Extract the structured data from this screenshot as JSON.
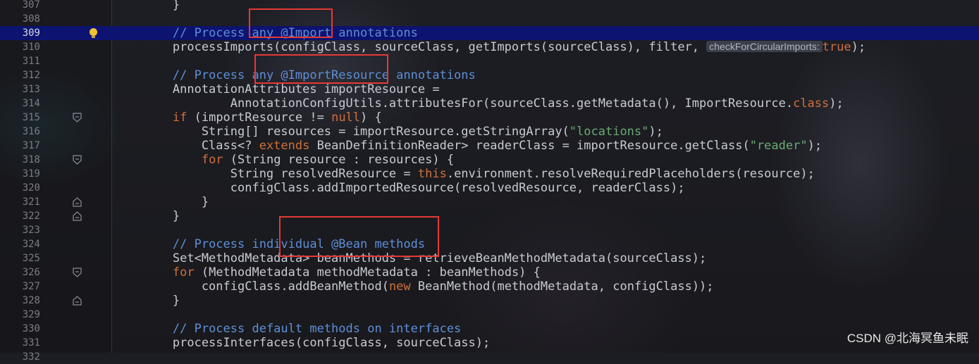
{
  "editor": {
    "current_line": "309",
    "param_hint": "checkForCircularImports:",
    "lines": [
      {
        "num": "307",
        "tokens": [
          {
            "c": "",
            "t": "        }"
          }
        ]
      },
      {
        "num": "308",
        "tokens": []
      },
      {
        "num": "309",
        "tokens": [
          {
            "c": "",
            "t": "        "
          },
          {
            "c": "t-cm",
            "t": "// Process any @Import annotations"
          }
        ]
      },
      {
        "num": "310",
        "tokens": [
          {
            "c": "",
            "t": "        processImports(configClass, sourceClass, getImports(sourceClass), filter, "
          },
          {
            "c": "hint",
            "t": ""
          },
          {
            "c": "t-kw",
            "t": "true"
          },
          {
            "c": "",
            "t": ");"
          }
        ]
      },
      {
        "num": "311",
        "tokens": []
      },
      {
        "num": "312",
        "tokens": [
          {
            "c": "",
            "t": "        "
          },
          {
            "c": "t-cm",
            "t": "// Process any @ImportResource annotations"
          }
        ]
      },
      {
        "num": "313",
        "tokens": [
          {
            "c": "",
            "t": "        AnnotationAttributes importResource ="
          }
        ]
      },
      {
        "num": "314",
        "tokens": [
          {
            "c": "",
            "t": "                AnnotationConfigUtils.attributesFor(sourceClass.getMetadata(), ImportResource."
          },
          {
            "c": "t-kw",
            "t": "class"
          },
          {
            "c": "",
            "t": ");"
          }
        ]
      },
      {
        "num": "315",
        "tokens": [
          {
            "c": "",
            "t": "        "
          },
          {
            "c": "t-kw",
            "t": "if"
          },
          {
            "c": "",
            "t": " (importResource != "
          },
          {
            "c": "t-kw",
            "t": "null"
          },
          {
            "c": "",
            "t": ") {"
          }
        ]
      },
      {
        "num": "316",
        "tokens": [
          {
            "c": "",
            "t": "            String[] resources = importResource.getStringArray("
          },
          {
            "c": "t-str",
            "t": "\"locations\""
          },
          {
            "c": "",
            "t": ");"
          }
        ]
      },
      {
        "num": "317",
        "tokens": [
          {
            "c": "",
            "t": "            Class<? "
          },
          {
            "c": "t-kw",
            "t": "extends"
          },
          {
            "c": "",
            "t": " BeanDefinitionReader> readerClass = importResource.getClass("
          },
          {
            "c": "t-str",
            "t": "\"reader\""
          },
          {
            "c": "",
            "t": ");"
          }
        ]
      },
      {
        "num": "318",
        "tokens": [
          {
            "c": "",
            "t": "            "
          },
          {
            "c": "t-kw",
            "t": "for"
          },
          {
            "c": "",
            "t": " (String resource : resources) {"
          }
        ]
      },
      {
        "num": "319",
        "tokens": [
          {
            "c": "",
            "t": "                String resolvedResource = "
          },
          {
            "c": "t-kw",
            "t": "this"
          },
          {
            "c": "",
            "t": ".environment.resolveRequiredPlaceholders(resource);"
          }
        ]
      },
      {
        "num": "320",
        "tokens": [
          {
            "c": "",
            "t": "                configClass.addImportedResource(resolvedResource, readerClass);"
          }
        ]
      },
      {
        "num": "321",
        "tokens": [
          {
            "c": "",
            "t": "            }"
          }
        ]
      },
      {
        "num": "322",
        "tokens": [
          {
            "c": "",
            "t": "        }"
          }
        ]
      },
      {
        "num": "323",
        "tokens": []
      },
      {
        "num": "324",
        "tokens": [
          {
            "c": "",
            "t": "        "
          },
          {
            "c": "t-cm",
            "t": "// Process individual @Bean methods"
          }
        ]
      },
      {
        "num": "325",
        "tokens": [
          {
            "c": "",
            "t": "        Set<MethodMetadata> beanMethods = retrieveBeanMethodMetadata(sourceClass);"
          }
        ]
      },
      {
        "num": "326",
        "tokens": [
          {
            "c": "",
            "t": "        "
          },
          {
            "c": "t-kw",
            "t": "for"
          },
          {
            "c": "",
            "t": " (MethodMetadata methodMetadata : beanMethods) {"
          }
        ]
      },
      {
        "num": "327",
        "tokens": [
          {
            "c": "",
            "t": "            configClass.addBeanMethod("
          },
          {
            "c": "t-kw",
            "t": "new"
          },
          {
            "c": "",
            "t": " BeanMethod(methodMetadata, configClass));"
          }
        ]
      },
      {
        "num": "328",
        "tokens": [
          {
            "c": "",
            "t": "        }"
          }
        ]
      },
      {
        "num": "329",
        "tokens": []
      },
      {
        "num": "330",
        "tokens": [
          {
            "c": "",
            "t": "        "
          },
          {
            "c": "t-cm",
            "t": "// Process default methods on interfaces"
          }
        ]
      },
      {
        "num": "331",
        "tokens": [
          {
            "c": "",
            "t": "        processInterfaces(configClass, sourceClass);"
          }
        ]
      },
      {
        "num": "332",
        "tokens": []
      }
    ]
  },
  "fold_markers": {
    "315": "fold-open-icon",
    "318": "fold-open-icon",
    "321": "fold-close-icon",
    "322": "fold-close-icon",
    "326": "fold-open-icon",
    "328": "fold-close-icon"
  },
  "gutter_icon_line": "309",
  "gutter_icon": "lightbulb-icon",
  "annotation_boxes": [
    "import-annotation-highlight",
    "importresource-annotation-highlight",
    "bean-annotation-highlight"
  ],
  "colors": {
    "highlight_box": "#e53935",
    "current_line": "#0d1370",
    "keyword": "#d0703a",
    "comment": "#5f8fd6",
    "string": "#6aab73"
  },
  "watermark": "CSDN @北海冥鱼未眠"
}
